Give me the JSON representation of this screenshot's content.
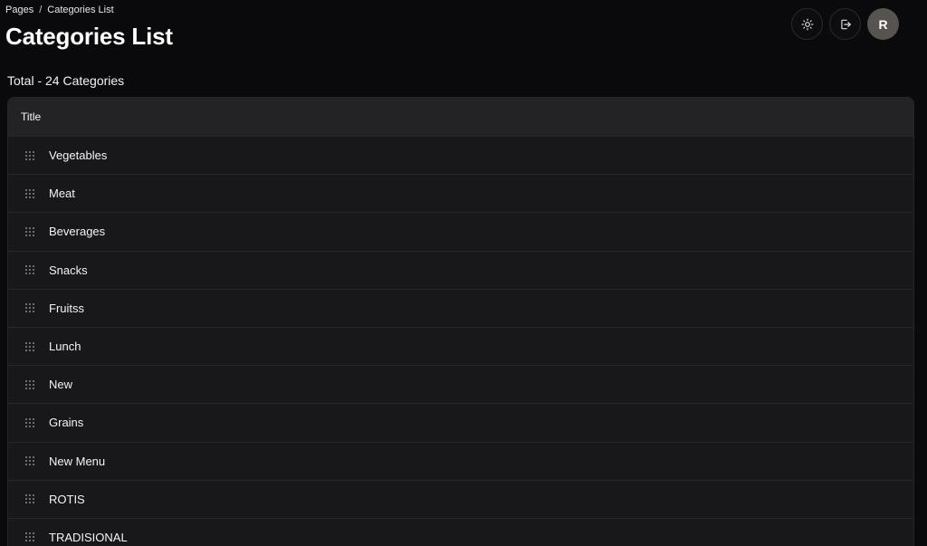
{
  "breadcrumb": {
    "parent": "Pages",
    "separator": "/",
    "current": "Categories List"
  },
  "page": {
    "title": "Categories List",
    "total": "Total - 24 Categories"
  },
  "header_actions": {
    "theme_icon": "sun-icon",
    "logout_icon": "logout-icon",
    "avatar_initial": "R",
    "avatar_color": "#57534e"
  },
  "table": {
    "column_title": "Title",
    "rows": [
      {
        "title": "Vegetables"
      },
      {
        "title": "Meat"
      },
      {
        "title": "Beverages"
      },
      {
        "title": "Snacks"
      },
      {
        "title": "Fruitss"
      },
      {
        "title": "Lunch"
      },
      {
        "title": "New"
      },
      {
        "title": "Grains"
      },
      {
        "title": "New Menu"
      },
      {
        "title": "ROTIS"
      },
      {
        "title": "TRADISIONAL"
      }
    ]
  },
  "colors": {
    "background": "#0a0a0c",
    "table_bg": "#18181b",
    "header_bg": "#232326",
    "border": "#27272a"
  }
}
